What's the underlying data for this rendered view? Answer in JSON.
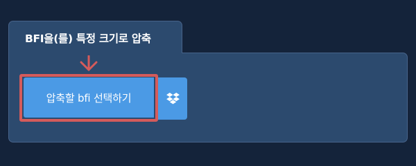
{
  "tab": {
    "title": "BFI을(를) 특정 크기로 압축"
  },
  "upload": {
    "select_label": "압축할 bfi 선택하기"
  },
  "dropbox": {
    "icon": "dropbox-icon"
  },
  "colors": {
    "page_background": "#14233a",
    "panel_background": "#2c4a6e",
    "button_blue": "#4b9ae5",
    "highlight_red": "#d55b5b"
  }
}
